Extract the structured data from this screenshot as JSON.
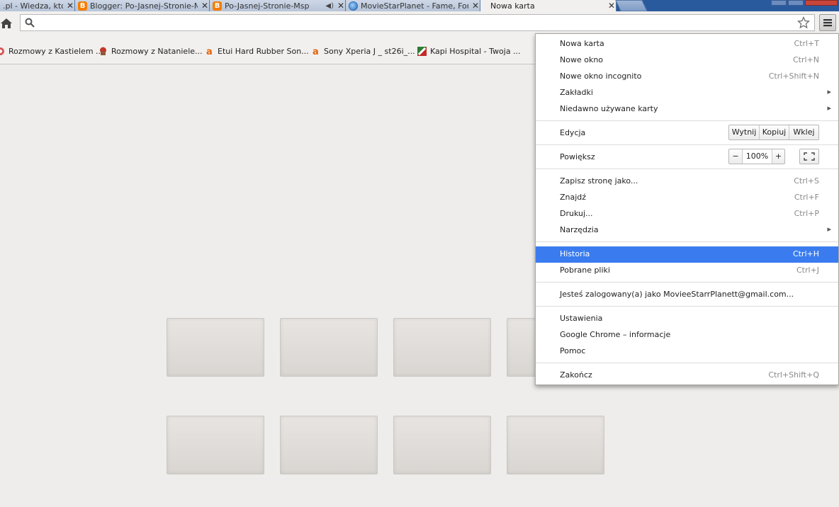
{
  "tabs": [
    {
      "title": ".pl - Wiedza, któ",
      "icon": "none"
    },
    {
      "title": "Blogger: Po-Jasnej-Stronie-M",
      "icon": "blogger-icon"
    },
    {
      "title": "Po-Jasnej-Stronie-Msp",
      "icon": "blogger-icon"
    },
    {
      "title": "MovieStarPlanet - Fame, For",
      "icon": "globe-icon"
    },
    {
      "title": "Nowa karta",
      "icon": "none"
    }
  ],
  "close_glyph": "✕",
  "audio_glyph": "◀)",
  "omnibox": {
    "value": "",
    "placeholder": ""
  },
  "bookmarks": [
    {
      "label": "Rozmowy z Kastielem ...",
      "icon": "bookmark-favicon-icon"
    },
    {
      "label": "Rozmowy z Nataniele...",
      "icon": "cupcake-icon"
    },
    {
      "label": "Etui Hard Rubber Son...",
      "icon": "amazon-icon"
    },
    {
      "label": "Sony Xperia J _ st26i_...",
      "icon": "amazon-icon"
    },
    {
      "label": "Kapi Hospital - Twoja ...",
      "icon": "kapi-hospital-icon"
    }
  ],
  "menu": {
    "new_tab": {
      "label": "Nowa karta",
      "shortcut": "Ctrl+T"
    },
    "new_window": {
      "label": "Nowe okno",
      "shortcut": "Ctrl+N"
    },
    "incognito": {
      "label": "Nowe okno incognito",
      "shortcut": "Ctrl+Shift+N"
    },
    "bookmarks": {
      "label": "Zakładki"
    },
    "recent_tabs": {
      "label": "Niedawno używane karty"
    },
    "edit": {
      "label": "Edycja",
      "cut": "Wytnij",
      "copy": "Kopiuj",
      "paste": "Wklej"
    },
    "zoom": {
      "label": "Powiększ",
      "minus": "−",
      "value": "100%",
      "plus": "+"
    },
    "save_page": {
      "label": "Zapisz stronę jako...",
      "shortcut": "Ctrl+S"
    },
    "find": {
      "label": "Znajdź",
      "shortcut": "Ctrl+F"
    },
    "print": {
      "label": "Drukuj...",
      "shortcut": "Ctrl+P"
    },
    "tools": {
      "label": "Narzędzia"
    },
    "history": {
      "label": "Historia",
      "shortcut": "Ctrl+H"
    },
    "downloads": {
      "label": "Pobrane pliki",
      "shortcut": "Ctrl+J"
    },
    "signed_in": {
      "label": "Jesteś zalogowany(a) jako MovieeStarrPlanett@gmail.com..."
    },
    "settings": {
      "label": "Ustawienia"
    },
    "about": {
      "label": "Google Chrome – informacje"
    },
    "help": {
      "label": "Pomoc"
    },
    "exit": {
      "label": "Zakończ",
      "shortcut": "Ctrl+Shift+Q"
    },
    "submenu_arrow": "▸"
  },
  "colors": {
    "highlight": "#3a7cf0",
    "tabstrip": "#2a5a9e",
    "page_bg": "#efedeb"
  }
}
